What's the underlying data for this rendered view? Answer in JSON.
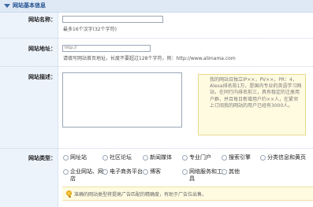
{
  "section": {
    "title": "网站基本信息"
  },
  "form": {
    "name": {
      "label": "网站名称：",
      "value": "",
      "hint": "最多16个汉字(32个字符)"
    },
    "url": {
      "label": "网站地址：",
      "placeholder": "http://",
      "hint": "请填写网站首页地址，长度不要超过128个字符，例：http://www.alimama.com"
    },
    "description": {
      "label": "网站描述：",
      "value": "",
      "tip": "我的网站日独立IP××，PV××，PR：4，Alexa排名前1万，是国内专业的英语学习网站，在同行内排名前三，具有稳定的注册用户群，并且每日新增用户约××人，在紧邻上订阅我的网站的用户已经有3000人。"
    },
    "type": {
      "label": "网站类型：",
      "options": [
        {
          "label": "网址站"
        },
        {
          "label": "社区论坛"
        },
        {
          "label": "新闻媒体"
        },
        {
          "label": "专业门户"
        },
        {
          "label": "搜索引擎"
        },
        {
          "label": "分类信息和黄页"
        },
        {
          "label": "企业网站、网店"
        },
        {
          "label": "电子商务平台"
        },
        {
          "label": "博客"
        },
        {
          "label": "网络服务和工具"
        },
        {
          "label": "其他"
        }
      ],
      "tip": "准确的网站类型将提高广告匹配的精确度，有助于广告位出售。"
    }
  }
}
